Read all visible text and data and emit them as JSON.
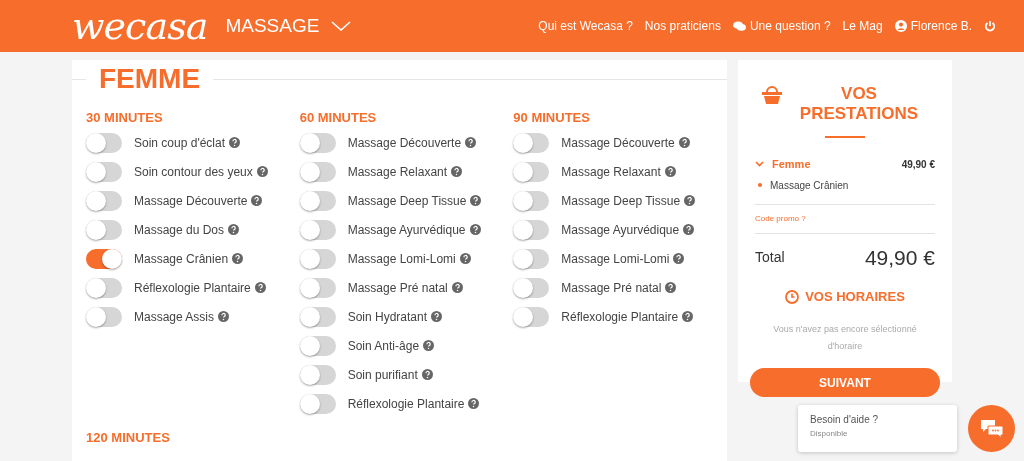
{
  "header": {
    "logo": "wecasa",
    "category": "MASSAGE",
    "nav": [
      {
        "label": "Qui est Wecasa ?",
        "kind": "link"
      },
      {
        "label": "Nos praticiens",
        "kind": "link"
      },
      {
        "label": "Une question ?",
        "kind": "question"
      },
      {
        "label": "Le Mag",
        "kind": "link"
      },
      {
        "label": "Florence B.",
        "kind": "account"
      }
    ]
  },
  "section": {
    "title": "FEMME",
    "groups": [
      {
        "title": "30 MINUTES",
        "items": [
          {
            "label": "Soin coup d'éclat",
            "on": false
          },
          {
            "label": "Soin contour des yeux",
            "on": false
          },
          {
            "label": "Massage Découverte",
            "on": false
          },
          {
            "label": "Massage du Dos",
            "on": false
          },
          {
            "label": "Massage Crânien",
            "on": true
          },
          {
            "label": "Réflexologie Plantaire",
            "on": false
          },
          {
            "label": "Massage Assis",
            "on": false
          }
        ]
      },
      {
        "title": "60 MINUTES",
        "items": [
          {
            "label": "Massage Découverte",
            "on": false
          },
          {
            "label": "Massage Relaxant",
            "on": false
          },
          {
            "label": "Massage Deep Tissue",
            "on": false
          },
          {
            "label": "Massage Ayurvédique",
            "on": false
          },
          {
            "label": "Massage Lomi-Lomi",
            "on": false
          },
          {
            "label": "Massage Pré natal",
            "on": false
          },
          {
            "label": "Soin Hydratant",
            "on": false
          },
          {
            "label": "Soin Anti-âge",
            "on": false
          },
          {
            "label": "Soin purifiant",
            "on": false
          },
          {
            "label": "Réflexologie Plantaire",
            "on": false
          }
        ]
      },
      {
        "title": "90 MINUTES",
        "items": [
          {
            "label": "Massage Découverte",
            "on": false
          },
          {
            "label": "Massage Relaxant",
            "on": false
          },
          {
            "label": "Massage Deep Tissue",
            "on": false
          },
          {
            "label": "Massage Ayurvédique",
            "on": false
          },
          {
            "label": "Massage Lomi-Lomi",
            "on": false
          },
          {
            "label": "Massage Pré natal",
            "on": false
          },
          {
            "label": "Réflexologie Plantaire",
            "on": false
          }
        ]
      }
    ],
    "next_group": "120 MINUTES"
  },
  "cart": {
    "title": "VOS PRESTATIONS",
    "group": {
      "name": "Femme",
      "price": "49,90 €",
      "expanded": true,
      "items": [
        "Massage Crânien"
      ]
    },
    "promo": "Code promo ?",
    "total_label": "Total",
    "total": "49,90 €",
    "schedule_title": "VOS HORAIRES",
    "schedule_note": "Vous n'avez pas encore sélectionné d'horaire",
    "next_button": "SUIVANT"
  },
  "chat": {
    "title": "Besoin d'aide ?",
    "status": "Disponible"
  }
}
